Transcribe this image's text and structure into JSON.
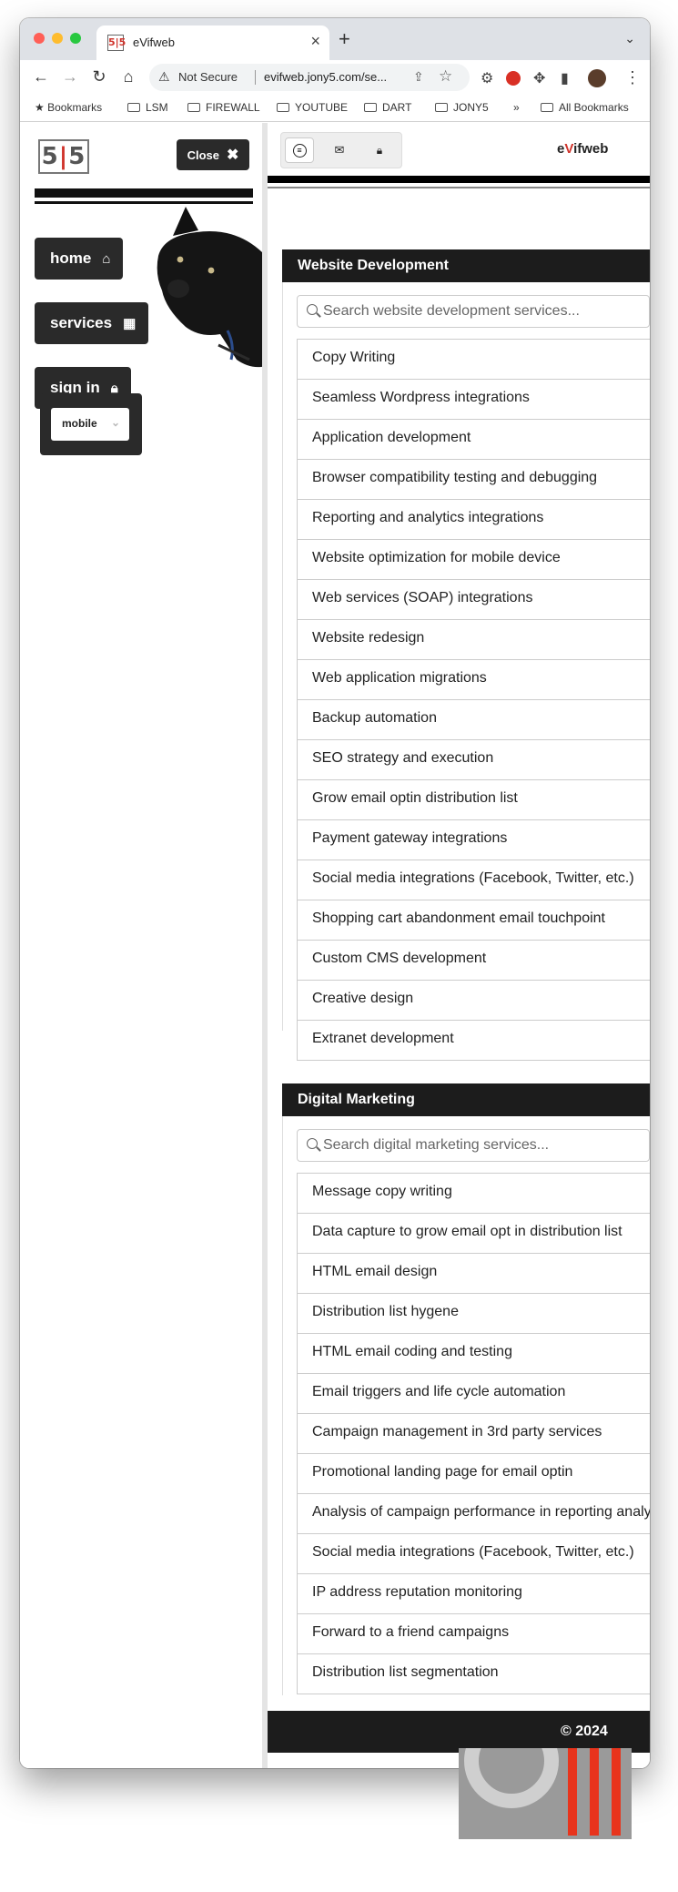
{
  "browser": {
    "tab_title": "eVifweb",
    "tab_favicon": "5|5",
    "new_tab": "+",
    "not_secure": "Not Secure",
    "url": "evifweb.jony5.com/se...",
    "bookmarks": [
      "Bookmarks",
      "LSM",
      "FIREWALL",
      "YOUTUBE",
      "DART",
      "JONY5"
    ],
    "bookmarks_more": "»",
    "all_bookmarks": "All Bookmarks"
  },
  "sidebar": {
    "logo_left": "5",
    "logo_right": "5",
    "close_label": "Close",
    "nav": {
      "home": "home",
      "services": "services",
      "sign_in": "sign in"
    },
    "mobile_select": "mobile"
  },
  "header": {
    "brand_pre": "e",
    "brand_v": "V",
    "brand_post": "ifweb"
  },
  "web_dev": {
    "title": "Website Development",
    "search_placeholder": "Search website development services...",
    "items": [
      "Copy Writing",
      "Seamless Wordpress integrations",
      "Application development",
      "Browser compatibility testing and debugging",
      "Reporting and analytics integrations",
      "Website optimization for mobile device",
      "Web services (SOAP) integrations",
      "Website redesign",
      "Web application migrations",
      "Backup automation",
      "SEO strategy and execution",
      "Grow email optin distribution list",
      "Payment gateway integrations",
      "Social media integrations (Facebook, Twitter, etc.)",
      "Shopping cart abandonment email touchpoint",
      "Custom CMS development",
      "Creative design",
      "Extranet development"
    ]
  },
  "digital_marketing": {
    "title": "Digital Marketing",
    "search_placeholder": "Search digital marketing services...",
    "items": [
      "Message copy writing",
      "Data capture to grow email opt in distribution list",
      "HTML email design",
      "Distribution list hygene",
      "HTML email coding and testing",
      "Email triggers and life cycle automation",
      "Campaign management in 3rd party services",
      "Promotional landing page for email optin",
      "Analysis of campaign performance in reporting analy",
      "Social media integrations (Facebook, Twitter, etc.)",
      "IP address reputation monitoring",
      "Forward to a friend campaigns",
      "Distribution list segmentation"
    ]
  },
  "footer": {
    "copyright": "© 2024"
  },
  "icons": {
    "home": "home-icon",
    "services": "grid-icon",
    "sign_in": "lock-icon",
    "close": "close-icon",
    "menu": "hamburger-icon",
    "mail": "mail-icon",
    "lock": "lock-icon",
    "search": "search-icon"
  },
  "colors": {
    "accent_red": "#d0342c",
    "dark": "#1c1c1c"
  }
}
